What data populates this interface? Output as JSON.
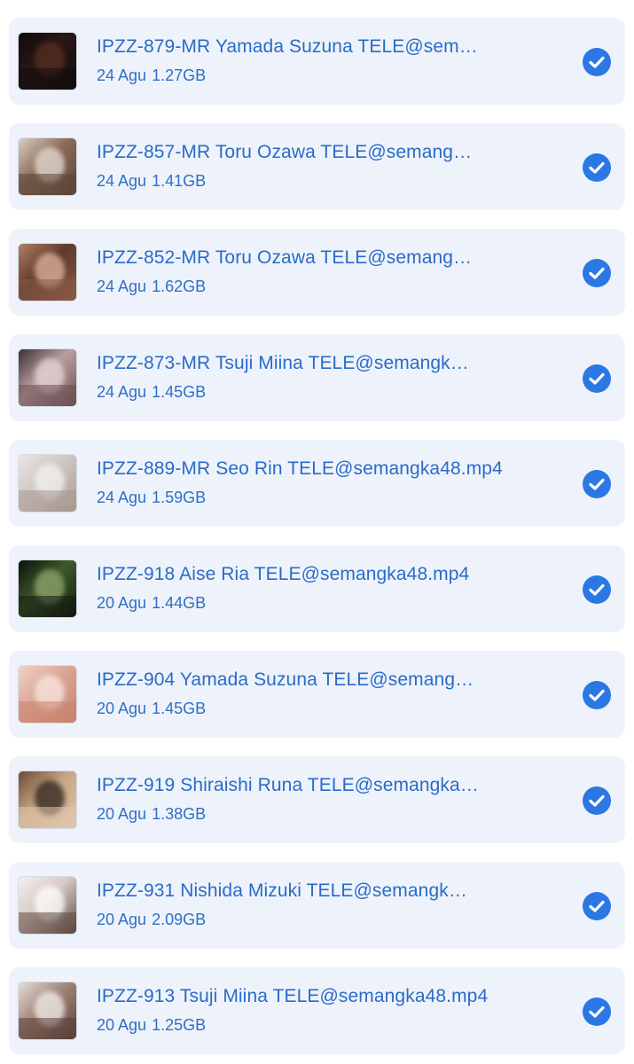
{
  "files": [
    {
      "name": "IPZZ-879-MR Yamada Suzuna TELE@sem…",
      "date": "24 Agu",
      "size": "1.27GB",
      "thumb_colors": [
        "#0e0a0a",
        "#2a1816",
        "#5a2e22",
        "#120d0c"
      ],
      "selected": true,
      "checkmark_icon": "checkmark-icon"
    },
    {
      "name": "IPZZ-857-MR Toru Ozawa TELE@semang…",
      "date": "24 Agu",
      "size": "1.41GB",
      "thumb_colors": [
        "#d9cfc6",
        "#8a6b58",
        "#e7ded6",
        "#5b4538"
      ],
      "selected": true,
      "checkmark_icon": "checkmark-icon"
    },
    {
      "name": "IPZZ-852-MR Toru Ozawa TELE@semang…",
      "date": "24 Agu",
      "size": "1.62GB",
      "thumb_colors": [
        "#b27f62",
        "#5e3a2c",
        "#e0b9a0",
        "#8a5a45"
      ],
      "selected": true,
      "checkmark_icon": "checkmark-icon"
    },
    {
      "name": "IPZZ-873-MR Tsuji Miina TELE@semangk…",
      "date": "24 Agu",
      "size": "1.45GB",
      "thumb_colors": [
        "#3a3032",
        "#b99ea1",
        "#e6d6d6",
        "#6d4f52"
      ],
      "selected": true,
      "checkmark_icon": "checkmark-icon"
    },
    {
      "name": "IPZZ-889-MR Seo Rin TELE@semangka48.mp4",
      "date": "24 Agu",
      "size": "1.59GB",
      "thumb_colors": [
        "#e9e6e4",
        "#cfc7c2",
        "#f4f2f0",
        "#a89990"
      ],
      "selected": true,
      "checkmark_icon": "checkmark-icon"
    },
    {
      "name": "IPZZ-918 Aise Ria TELE@semangka48.mp4",
      "date": "20 Agu",
      "size": "1.44GB",
      "thumb_colors": [
        "#0b100a",
        "#3e5a2c",
        "#8fa76c",
        "#141a10"
      ],
      "selected": true,
      "checkmark_icon": "checkmark-icon"
    },
    {
      "name": "IPZZ-904 Yamada Suzuna TELE@semang…",
      "date": "20 Agu",
      "size": "1.45GB",
      "thumb_colors": [
        "#f0d3c8",
        "#dba595",
        "#f8e8e0",
        "#c9836d"
      ],
      "selected": true,
      "checkmark_icon": "checkmark-icon"
    },
    {
      "name": "IPZZ-919 Shiraishi Runa TELE@semangka…",
      "date": "20 Agu",
      "size": "1.38GB",
      "thumb_colors": [
        "#6b4a35",
        "#c7a585",
        "#2b221d",
        "#e0c6ad"
      ],
      "selected": true,
      "checkmark_icon": "checkmark-icon"
    },
    {
      "name": "IPZZ-931 Nishida Mizuki TELE@semangk…",
      "date": "20 Agu",
      "size": "2.09GB",
      "thumb_colors": [
        "#f2f0ef",
        "#d8c9c3",
        "#ffffff",
        "#5e4a42"
      ],
      "selected": true,
      "checkmark_icon": "checkmark-icon"
    },
    {
      "name": "IPZZ-913 Tsuji Miina TELE@semangka48.mp4",
      "date": "20 Agu",
      "size": "1.25GB",
      "thumb_colors": [
        "#e4ddd8",
        "#9f8478",
        "#f5f1ee",
        "#5a4038"
      ],
      "selected": true,
      "checkmark_icon": "checkmark-icon"
    }
  ],
  "colors": {
    "row_background": "#eef3fb",
    "title_text": "#2a6bc8",
    "meta_text": "#2f6fc5",
    "check_fill": "#2b78e4"
  }
}
